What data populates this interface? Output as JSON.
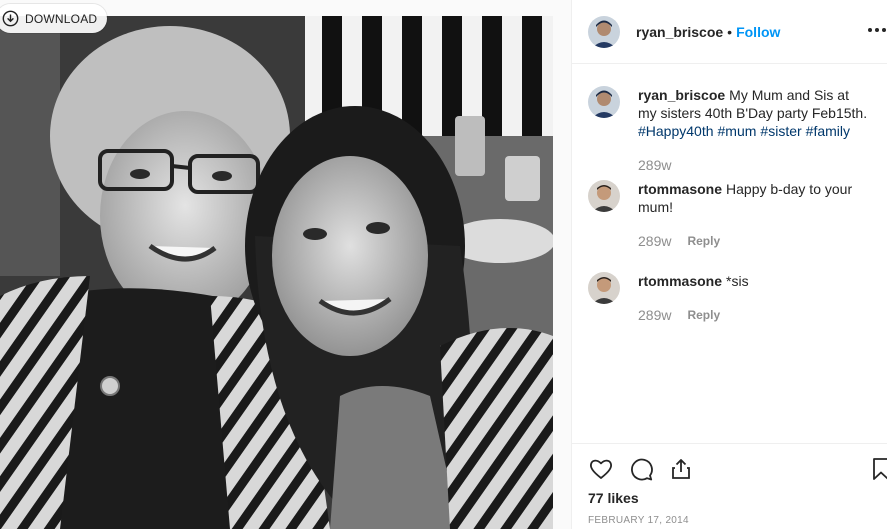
{
  "download": {
    "label": "DOWNLOAD"
  },
  "header": {
    "username": "ryan_briscoe",
    "separator": "•",
    "follow_label": "Follow"
  },
  "caption": {
    "username": "ryan_briscoe",
    "text": "My Mum and Sis at my sisters 40th B'Day party Feb15th.",
    "hashtags": [
      "#Happy40th",
      "#mum",
      "#sister",
      "#family"
    ],
    "time": "289w"
  },
  "comments": [
    {
      "username": "rtommasone",
      "text": "Happy b-day to your mum!",
      "time": "289w",
      "reply_label": "Reply"
    },
    {
      "username": "rtommasone",
      "text": "*sis",
      "time": "289w",
      "reply_label": "Reply"
    }
  ],
  "actions": {
    "icons": [
      "heart-icon",
      "comment-bubble-icon",
      "share-icon",
      "bookmark-icon"
    ],
    "likes": "77 likes",
    "date": "FEBRUARY 17, 2014"
  },
  "colors": {
    "link_blue": "#0095f6",
    "hashtag_blue": "#00376b",
    "muted_gray": "#8e8e8e",
    "text_dark": "#262626",
    "divider": "#efefef"
  }
}
